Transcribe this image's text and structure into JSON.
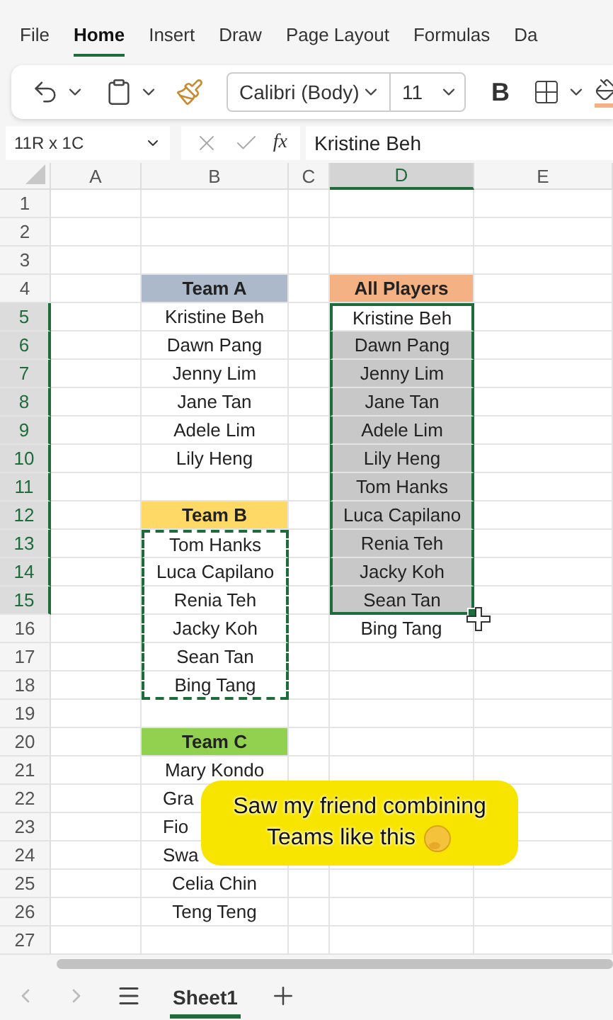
{
  "ribbon_tabs": [
    {
      "label": "File",
      "selected": false
    },
    {
      "label": "Home",
      "selected": true
    },
    {
      "label": "Insert",
      "selected": false
    },
    {
      "label": "Draw",
      "selected": false
    },
    {
      "label": "Page Layout",
      "selected": false
    },
    {
      "label": "Formulas",
      "selected": false
    },
    {
      "label": "Da",
      "selected": false
    }
  ],
  "toolbar": {
    "font": "Calibri (Body)",
    "font_size": "11",
    "bold_label": "B"
  },
  "formula_bar": {
    "name_box": "11R x 1C",
    "function_label": "fx",
    "value": "Kristine Beh"
  },
  "columns": [
    {
      "label": "A",
      "selected": false
    },
    {
      "label": "B",
      "selected": false
    },
    {
      "label": "C",
      "selected": false
    },
    {
      "label": "D",
      "selected": true
    },
    {
      "label": "E",
      "selected": false
    }
  ],
  "rows": [
    {
      "number": "1",
      "selected": false
    },
    {
      "number": "2",
      "selected": false
    },
    {
      "number": "3",
      "selected": false
    },
    {
      "number": "4",
      "selected": false,
      "b": {
        "text": "Team A",
        "kind": "header",
        "color": "#acb9ca",
        "selected": false,
        "copied": false
      },
      "d": {
        "text": "All Players",
        "kind": "header",
        "color": "#f4b183",
        "selected": false,
        "copied": false
      }
    },
    {
      "number": "5",
      "selected": true,
      "b": {
        "text": "Kristine Beh",
        "kind": "plain",
        "selected": false,
        "copied": false
      },
      "d": {
        "text": "Kristine Beh",
        "kind": "plain",
        "selected": true,
        "active": true,
        "copied": false
      }
    },
    {
      "number": "6",
      "selected": true,
      "b": {
        "text": "Dawn Pang",
        "kind": "plain",
        "selected": false,
        "copied": false
      },
      "d": {
        "text": "Dawn Pang",
        "kind": "plain",
        "selected": true,
        "active": false,
        "copied": false
      }
    },
    {
      "number": "7",
      "selected": true,
      "b": {
        "text": "Jenny Lim",
        "kind": "plain",
        "selected": false,
        "copied": false
      },
      "d": {
        "text": "Jenny Lim",
        "kind": "plain",
        "selected": true,
        "active": false,
        "copied": false
      }
    },
    {
      "number": "8",
      "selected": true,
      "b": {
        "text": "Jane Tan",
        "kind": "plain",
        "selected": false,
        "copied": false
      },
      "d": {
        "text": "Jane Tan",
        "kind": "plain",
        "selected": true,
        "active": false,
        "copied": false
      }
    },
    {
      "number": "9",
      "selected": true,
      "b": {
        "text": "Adele Lim",
        "kind": "plain",
        "selected": false,
        "copied": false
      },
      "d": {
        "text": "Adele Lim",
        "kind": "plain",
        "selected": true,
        "active": false,
        "copied": false
      }
    },
    {
      "number": "10",
      "selected": true,
      "b": {
        "text": "Lily Heng",
        "kind": "plain",
        "selected": false,
        "copied": false
      },
      "d": {
        "text": "Lily Heng",
        "kind": "plain",
        "selected": true,
        "active": false,
        "copied": false
      }
    },
    {
      "number": "11",
      "selected": true,
      "d": {
        "text": "Tom Hanks",
        "kind": "plain",
        "selected": true,
        "active": false,
        "copied": false
      }
    },
    {
      "number": "12",
      "selected": true,
      "b": {
        "text": "Team B",
        "kind": "header",
        "color": "#ffd966",
        "selected": false,
        "copied": false
      },
      "d": {
        "text": "Luca Capilano",
        "kind": "plain",
        "selected": true,
        "active": false,
        "copied": false
      }
    },
    {
      "number": "13",
      "selected": true,
      "b": {
        "text": "Tom Hanks",
        "kind": "plain",
        "selected": false,
        "copied": true
      },
      "d": {
        "text": "Renia Teh",
        "kind": "plain",
        "selected": true,
        "active": false,
        "copied": false
      }
    },
    {
      "number": "14",
      "selected": true,
      "b": {
        "text": "Luca Capilano",
        "kind": "plain",
        "selected": false,
        "copied": true
      },
      "d": {
        "text": "Jacky Koh",
        "kind": "plain",
        "selected": true,
        "active": false,
        "copied": false
      }
    },
    {
      "number": "15",
      "selected": true,
      "b": {
        "text": "Renia Teh",
        "kind": "plain",
        "selected": false,
        "copied": true
      },
      "d": {
        "text": "Sean Tan",
        "kind": "plain",
        "selected": true,
        "active": false,
        "copied": false
      }
    },
    {
      "number": "16",
      "selected": false,
      "b": {
        "text": "Jacky Koh",
        "kind": "plain",
        "selected": false,
        "copied": true
      },
      "d": {
        "text": "Bing Tang",
        "kind": "plain",
        "selected": false,
        "copied": false
      }
    },
    {
      "number": "17",
      "selected": false,
      "b": {
        "text": "Sean Tan",
        "kind": "plain",
        "selected": false,
        "copied": true
      }
    },
    {
      "number": "18",
      "selected": false,
      "b": {
        "text": "Bing Tang",
        "kind": "plain",
        "selected": false,
        "copied": true
      }
    },
    {
      "number": "19",
      "selected": false
    },
    {
      "number": "20",
      "selected": false,
      "b": {
        "text": "Team C",
        "kind": "header",
        "color": "#92d050",
        "selected": false,
        "copied": false
      }
    },
    {
      "number": "21",
      "selected": false,
      "b": {
        "text": "Mary Kondo",
        "kind": "plain",
        "selected": false,
        "copied": false
      }
    },
    {
      "number": "22",
      "selected": false,
      "b": {
        "text": "Gra",
        "kind": "partial",
        "selected": false,
        "copied": false
      }
    },
    {
      "number": "23",
      "selected": false,
      "b": {
        "text": "Fio",
        "kind": "partial",
        "selected": false,
        "copied": false
      }
    },
    {
      "number": "24",
      "selected": false,
      "b": {
        "text": "Swa",
        "kind": "partial",
        "selected": false,
        "copied": false
      }
    },
    {
      "number": "25",
      "selected": false,
      "b": {
        "text": "Celia Chin",
        "kind": "plain",
        "selected": false,
        "copied": false
      }
    },
    {
      "number": "26",
      "selected": false,
      "b": {
        "text": "Teng Teng",
        "kind": "plain",
        "selected": false,
        "copied": false
      }
    },
    {
      "number": "27",
      "selected": false
    }
  ],
  "caption": {
    "lines": [
      "Saw my friend combining",
      "Teams like this"
    ]
  },
  "sheet_tabs": [
    {
      "label": "Sheet1",
      "selected": true
    }
  ]
}
